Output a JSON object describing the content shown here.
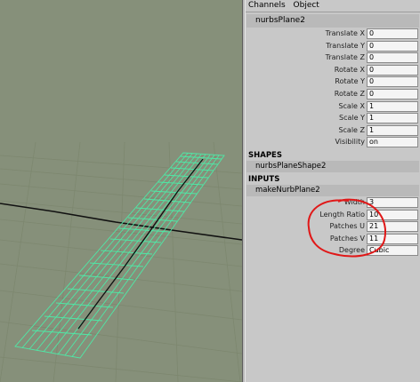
{
  "menu": {
    "channels": "Channels",
    "object": "Object"
  },
  "object_name": "nurbsPlane2",
  "channels": [
    {
      "label": "Translate X",
      "value": "0"
    },
    {
      "label": "Translate Y",
      "value": "0"
    },
    {
      "label": "Translate Z",
      "value": "0"
    },
    {
      "label": "Rotate X",
      "value": "0"
    },
    {
      "label": "Rotate Y",
      "value": "0"
    },
    {
      "label": "Rotate Z",
      "value": "0"
    },
    {
      "label": "Scale X",
      "value": "1"
    },
    {
      "label": "Scale Y",
      "value": "1"
    },
    {
      "label": "Scale Z",
      "value": "1"
    },
    {
      "label": "Visibility",
      "value": "on"
    }
  ],
  "shapes": {
    "header": "SHAPES",
    "name": "nurbsPlaneShape2"
  },
  "inputs": {
    "header": "INPUTS",
    "node": "makeNurbPlane2",
    "attributes": [
      {
        "label": "Width",
        "value": "3"
      },
      {
        "label": "Length Ratio",
        "value": "10"
      },
      {
        "label": "Patches U",
        "value": "21"
      },
      {
        "label": "Patches V",
        "value": "11"
      },
      {
        "label": "Degree",
        "value": "Cubic"
      }
    ]
  },
  "colors": {
    "viewport_bg": "#86907a",
    "wire": "#4fe8a6",
    "annotation": "#e01818",
    "panel_bg": "#c8c8c8"
  }
}
